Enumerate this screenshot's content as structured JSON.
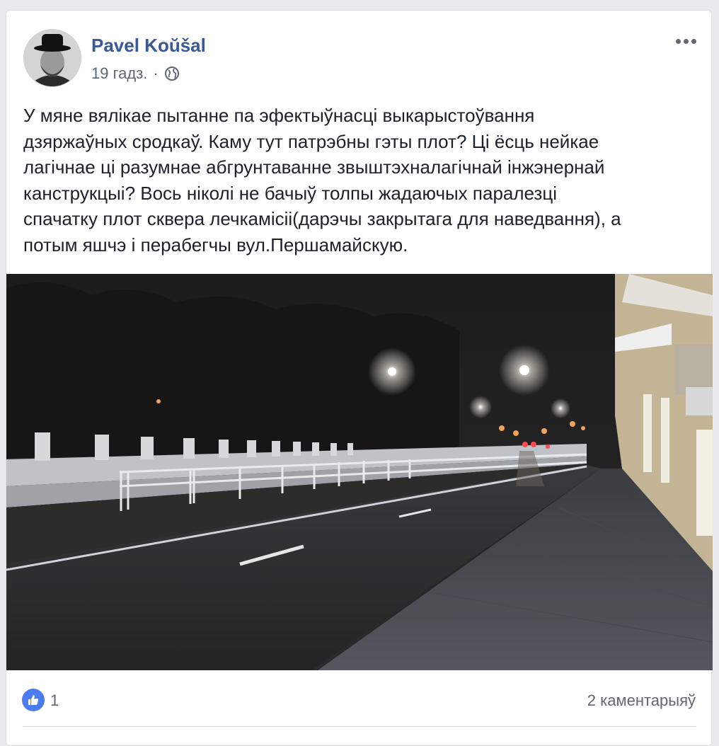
{
  "post": {
    "author": "Pavel Koŭšal",
    "time": "19 гадз.",
    "separator": "·",
    "privacy_icon": "globe-icon",
    "more_icon": "ellipsis-icon",
    "text": "У мяне вялікае пытанне па эфектыўнасці выкарыстоўвання\nдзяржаўных сродкаў. Каму тут патрэбны гэты плот? Ці ёсць нейкае\nлагічнае ці разумнае абгрунтаванне звыштэхналагічнай інжэнернай\nканструкцыі? Вось ніколі не бачыў толпы жадаючых паралезці\nспачатку плот сквера лечкамісіі(дарэчы закрытага для наведвання), а\nпотым яшчэ і перабегчы вул.Першамайскую."
  },
  "reactions": {
    "like_icon": "thumbs-up-icon",
    "like_count": "1",
    "comments_label": "2 каментарыяў"
  },
  "colors": {
    "author": "#385898",
    "muted": "#616770",
    "like_blue": "#4a7bf0"
  }
}
